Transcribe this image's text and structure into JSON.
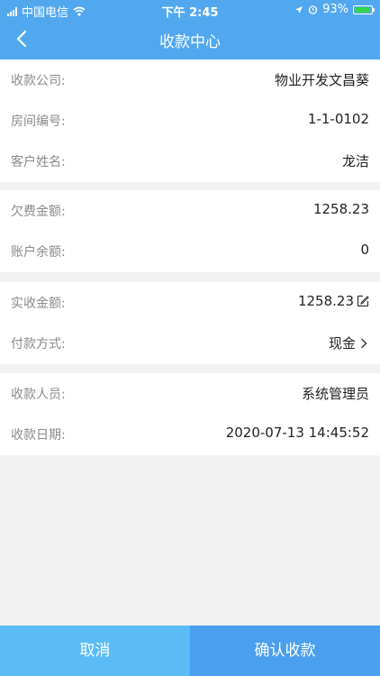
{
  "status_bar": {
    "carrier": "中国电信",
    "time": "下午 2:45",
    "battery": "93%",
    "battery_level": 0.93
  },
  "header": {
    "title": "收款中心",
    "back_icon": "chevron-left-icon"
  },
  "sections": [
    {
      "rows": [
        {
          "label": "收款公司:",
          "value": "物业开发文昌葵"
        },
        {
          "label": "房间编号:",
          "value": "1-1-0102"
        },
        {
          "label": "客户姓名:",
          "value": "龙洁"
        }
      ]
    },
    {
      "rows": [
        {
          "label": "欠费金额:",
          "value": "1258.23"
        },
        {
          "label": "账户余额:",
          "value": "0"
        }
      ]
    },
    {
      "rows": [
        {
          "label": "实收金额:",
          "value": "1258.23",
          "icon": "edit-icon"
        },
        {
          "label": "付款方式:",
          "value": "现金",
          "icon": "chevron-right-icon"
        }
      ]
    },
    {
      "rows": [
        {
          "label": "收款人员:",
          "value": "系统管理员"
        },
        {
          "label": "收款日期:",
          "value": "2020-07-13 14:45:52"
        }
      ]
    }
  ],
  "footer": {
    "cancel_label": "取消",
    "confirm_label": "确认收款"
  },
  "colors": {
    "header": "#52a8ef",
    "cancel_button": "#5bbcf5",
    "confirm_button": "#4a9fee",
    "background": "#f2f2f2"
  }
}
